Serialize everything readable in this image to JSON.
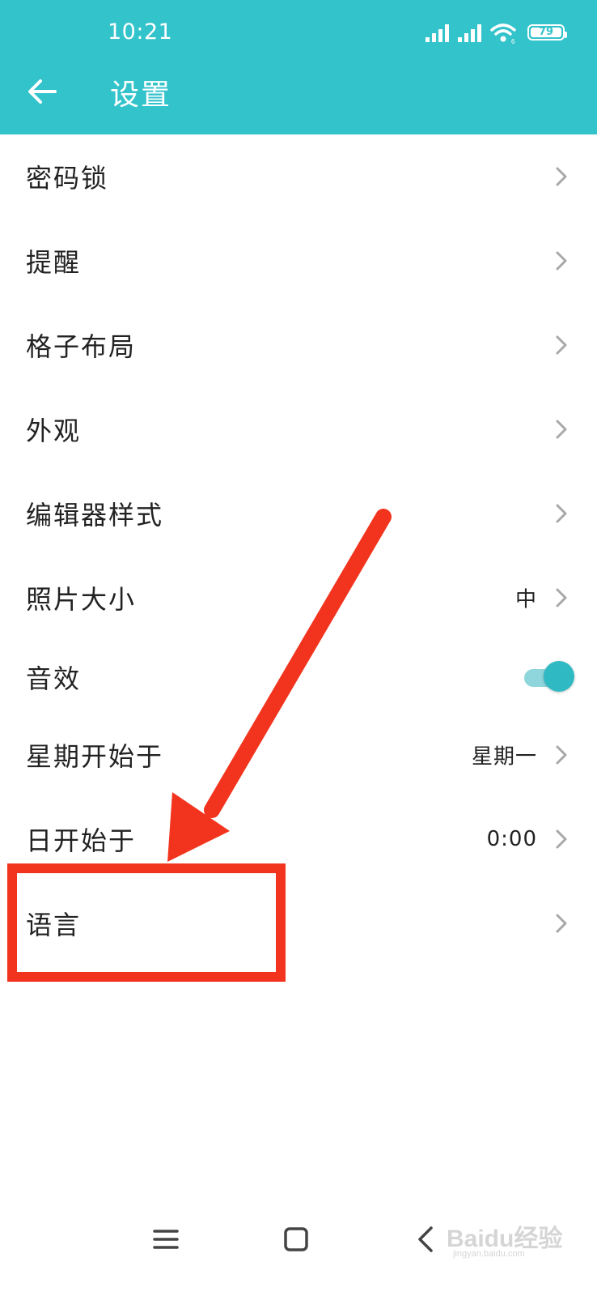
{
  "status_bar": {
    "time": "10:21",
    "battery": "79"
  },
  "header": {
    "title": "设置"
  },
  "settings": [
    {
      "label": "密码锁"
    },
    {
      "label": "提醒"
    },
    {
      "label": "格子布局"
    },
    {
      "label": "外观"
    },
    {
      "label": "编辑器样式"
    },
    {
      "label": "照片大小",
      "value": "中"
    },
    {
      "label": "音效",
      "toggle": true
    },
    {
      "label": "星期开始于",
      "value": "星期一"
    },
    {
      "label": "日开始于",
      "value": "0:00"
    },
    {
      "label": "语言"
    }
  ],
  "annotation": {
    "color": "#f2341e"
  },
  "theme": {
    "accent": "#33c3cb"
  },
  "watermark": {
    "text": "Baidu经验",
    "sub": "jingyan.baidu.com"
  }
}
